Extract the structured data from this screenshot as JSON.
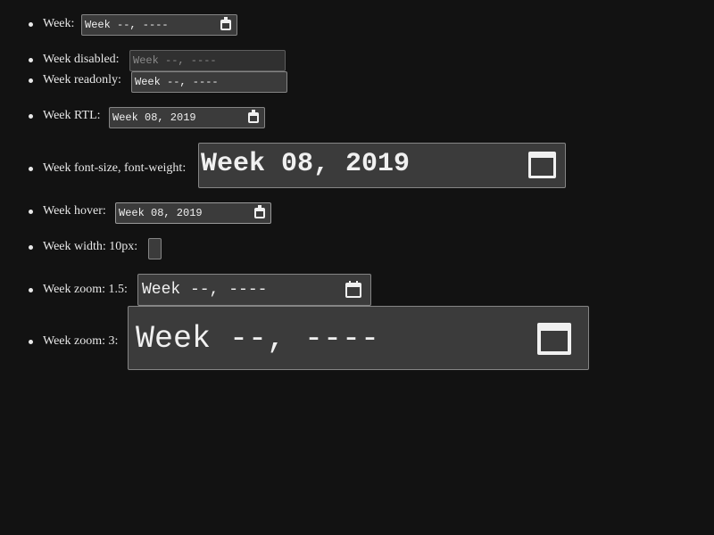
{
  "items": [
    {
      "label": "Week:",
      "value": "Week --, ----",
      "state": "normal"
    },
    {
      "label": "Week disabled:",
      "value": "Week --, ----",
      "state": "disabled"
    },
    {
      "label": "Week readonly:",
      "value": "Week --, ----",
      "state": "readonly"
    },
    {
      "label": "Week RTL:",
      "value": "Week 08, 2019",
      "state": "rtl"
    },
    {
      "label": "Week font-size, font-weight:",
      "value": "Week 08, 2019",
      "state": "large-bold"
    },
    {
      "label": "Week hover:",
      "value": "Week 08, 2019",
      "state": "hover"
    },
    {
      "label": "Week width: 10px:",
      "value": "",
      "state": "narrow"
    },
    {
      "label": "Week zoom: 1.5:",
      "value": "Week --, ----",
      "state": "zoom-1.5"
    },
    {
      "label": "Week zoom: 3:",
      "value": "Week --, ----",
      "state": "zoom-3"
    }
  ],
  "icons": {
    "calendar": "calendar-icon"
  },
  "colors": {
    "background": "#121212",
    "field": "#3b3b3b",
    "border": "#858585",
    "text": "#f0f0f0"
  }
}
